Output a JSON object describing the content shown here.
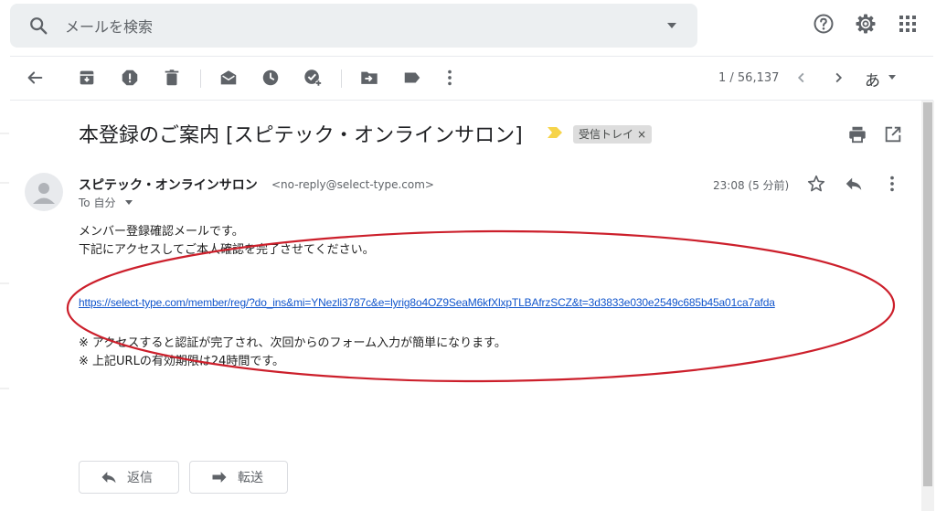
{
  "search": {
    "placeholder": "メールを検索"
  },
  "toolbar": {
    "pager": "1 / 56,137",
    "input_tools_label": "あ"
  },
  "email": {
    "subject": "本登録のご案内 [スピテック・オンラインサロン]",
    "label": "受信トレイ",
    "label_remove": "×",
    "sender_name": "スピテック・オンラインサロン",
    "sender_email": "<no-reply@select-type.com>",
    "to_me": "To 自分",
    "time": "23:08 (5 分前)",
    "body": {
      "line1": "メンバー登録確認メールです。",
      "line2": "下記にアクセスしてご本人確認を完了させてください。",
      "link": "https://select-type.com/member/reg/?do_ins&mi=YNezli3787c&e=lyrig8o4OZ9SeaM6kfXlxpTLBAfrzSCZ&t=3d3833e030e2549c685b45a01ca7afda",
      "note1": "※ アクセスすると認証が完了され、次回からのフォーム入力が簡単になります。",
      "note2": "※ 上記URLの有効期限は24時間です。"
    }
  },
  "actions": {
    "reply_label": "返信",
    "forward_label": "転送"
  },
  "colors": {
    "annotation": "#cc1f2b",
    "link": "#1155cc",
    "important_marker": "#f6d44a"
  }
}
